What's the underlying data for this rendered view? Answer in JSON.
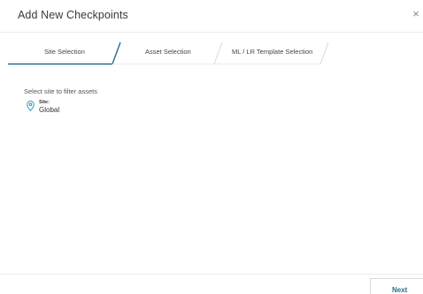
{
  "dialog": {
    "title": "Add New Checkpoints",
    "close_glyph": "×"
  },
  "steps": [
    {
      "label": "Site Selection",
      "active": true
    },
    {
      "label": "Asset Selection",
      "active": false
    },
    {
      "label": "ML / LR Template Selection",
      "active": false
    }
  ],
  "content": {
    "prompt": "Select site to filter assets",
    "site_label": "Site:",
    "site_value": "Global",
    "site_icon": "map-pin-icon"
  },
  "footer": {
    "next_label": "Next"
  },
  "colors": {
    "accent": "#1f6f8b",
    "divider": "#d9d9d9",
    "icon": "#1f8fb5"
  }
}
